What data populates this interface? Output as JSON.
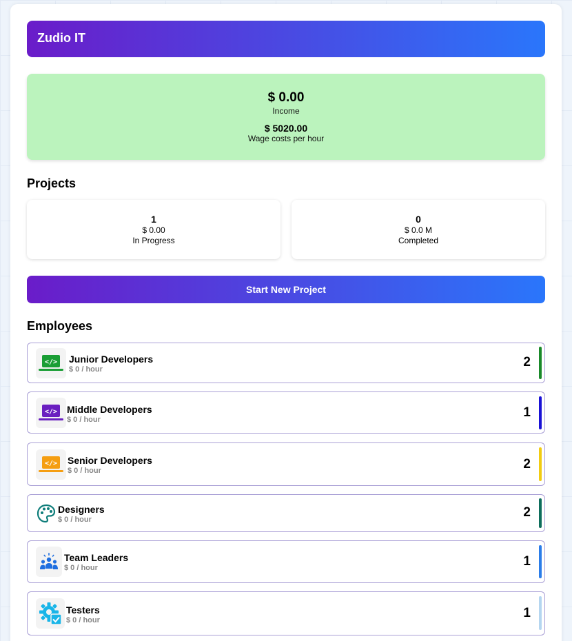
{
  "app": {
    "title": "Zudio IT"
  },
  "summary": {
    "income_value": "$ 0.00",
    "income_label": "Income",
    "wage_value": "$ 5020.00",
    "wage_label": "Wage costs per hour"
  },
  "projects": {
    "title": "Projects",
    "in_progress": {
      "count": "1",
      "amount": "$ 0.00",
      "label": "In Progress"
    },
    "completed": {
      "count": "0",
      "amount": "$ 0.0 M",
      "label": "Completed"
    },
    "start_button": "Start New Project"
  },
  "employees": {
    "title": "Employees",
    "items": [
      {
        "name": "Junior Developers",
        "rate": "$ 0 / hour",
        "count": "2",
        "icon": "laptop-code-icon",
        "color": "#1a8a2a"
      },
      {
        "name": "Middle Developers",
        "rate": "$ 0 / hour",
        "count": "1",
        "icon": "laptop-code-icon",
        "color": "#1a12d6"
      },
      {
        "name": "Senior Developers",
        "rate": "$ 0 / hour",
        "count": "2",
        "icon": "laptop-code-icon",
        "color": "#f2cc12"
      },
      {
        "name": "Designers",
        "rate": "$ 0 / hour",
        "count": "2",
        "icon": "palette-icon",
        "color": "#0e6e5c"
      },
      {
        "name": "Team Leaders",
        "rate": "$ 0 / hour",
        "count": "1",
        "icon": "team-icon",
        "color": "#2b7de9"
      },
      {
        "name": "Testers",
        "rate": "$ 0 / hour",
        "count": "1",
        "icon": "gear-check-icon",
        "color": "#b5d6f0"
      }
    ]
  },
  "colors": {
    "accent_start": "#6a1cc9",
    "accent_end": "#2a76fb",
    "summary_bg": "#bbf3bd",
    "card_border": "#a99fd6"
  }
}
